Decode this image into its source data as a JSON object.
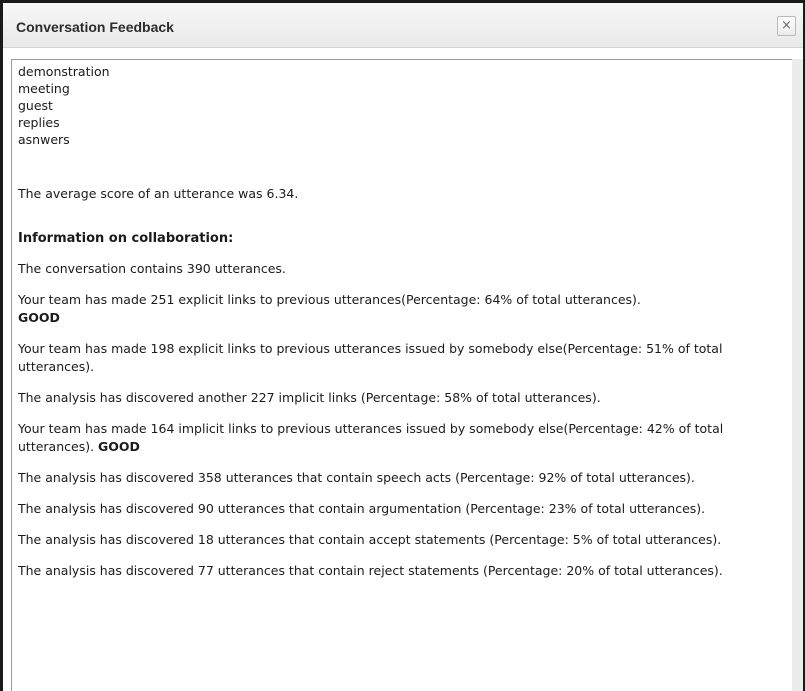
{
  "window": {
    "title": "Conversation Feedback",
    "close_glyph": "×"
  },
  "keywords": [
    "demonstration",
    "meeting",
    "guest",
    "replies",
    "asnwers"
  ],
  "average_score_text": "The average score of an utterance was 6.34.",
  "collaboration": {
    "heading": "Information on collaboration:",
    "paragraphs": [
      {
        "text": "The conversation contains 390 utterances.",
        "badge": ""
      },
      {
        "text": "Your team has made 251 explicit links to previous utterances(Percentage: 64% of total utterances).",
        "badge": "GOOD"
      },
      {
        "text": "Your team has made 198 explicit links to previous utterances issued by somebody else(Percentage: 51% of total utterances).",
        "badge": ""
      },
      {
        "text": "The analysis has discovered another 227 implicit links (Percentage: 58% of total utterances).",
        "badge": ""
      },
      {
        "text": "Your team has made 164 implicit links to previous utterances issued by somebody else(Percentage: 42% of total utterances).",
        "badge": "GOOD"
      },
      {
        "text": "The analysis has discovered 358 utterances that contain speech acts (Percentage: 92% of total utterances).",
        "badge": ""
      },
      {
        "text": "The analysis has discovered 90 utterances that contain argumentation (Percentage: 23% of total utterances).",
        "badge": ""
      },
      {
        "text": "The analysis has discovered 18 utterances that contain accept statements (Percentage: 5% of total utterances).",
        "badge": ""
      },
      {
        "text": "The analysis has discovered 77 utterances that contain reject statements (Percentage: 20% of total utterances).",
        "badge": ""
      }
    ]
  }
}
